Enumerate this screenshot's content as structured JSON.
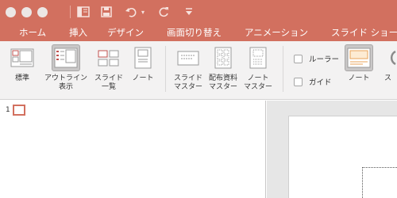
{
  "window": {
    "titlebar_color": "#d2705f",
    "controls": [
      "close",
      "minimize",
      "zoom"
    ]
  },
  "quick_access": {
    "icons": [
      "sidebar-toggle-icon",
      "save-icon",
      "undo-icon",
      "redo-icon",
      "customize-icon"
    ]
  },
  "tabs": [
    {
      "label": "ホーム"
    },
    {
      "label": "挿入"
    },
    {
      "label": "デザイン"
    },
    {
      "label": "画面切り替え"
    },
    {
      "label": "アニメーション"
    },
    {
      "label": "スライド ショー"
    }
  ],
  "ribbon": {
    "buttons": {
      "normal": {
        "line1": "標準",
        "line2": ""
      },
      "outline": {
        "line1": "アウトライン",
        "line2": "表示"
      },
      "sorter": {
        "line1": "スライド",
        "line2": "一覧"
      },
      "notes_page": {
        "line1": "ノート",
        "line2": ""
      },
      "slide_master": {
        "line1": "スライド",
        "line2": "マスター"
      },
      "handout_master": {
        "line1": "配布資料",
        "line2": "マスター"
      },
      "notes_master": {
        "line1": "ノート",
        "line2": "マスター"
      },
      "notes_toggle": {
        "line1": "ノート",
        "line2": ""
      },
      "cut_label": {
        "line1": "ス",
        "line2": ""
      }
    },
    "checkboxes": {
      "ruler": "ルーラー",
      "guides": "ガイド"
    }
  },
  "slides_pane": {
    "slide_number": "1"
  },
  "accent_color": "#d2705f"
}
